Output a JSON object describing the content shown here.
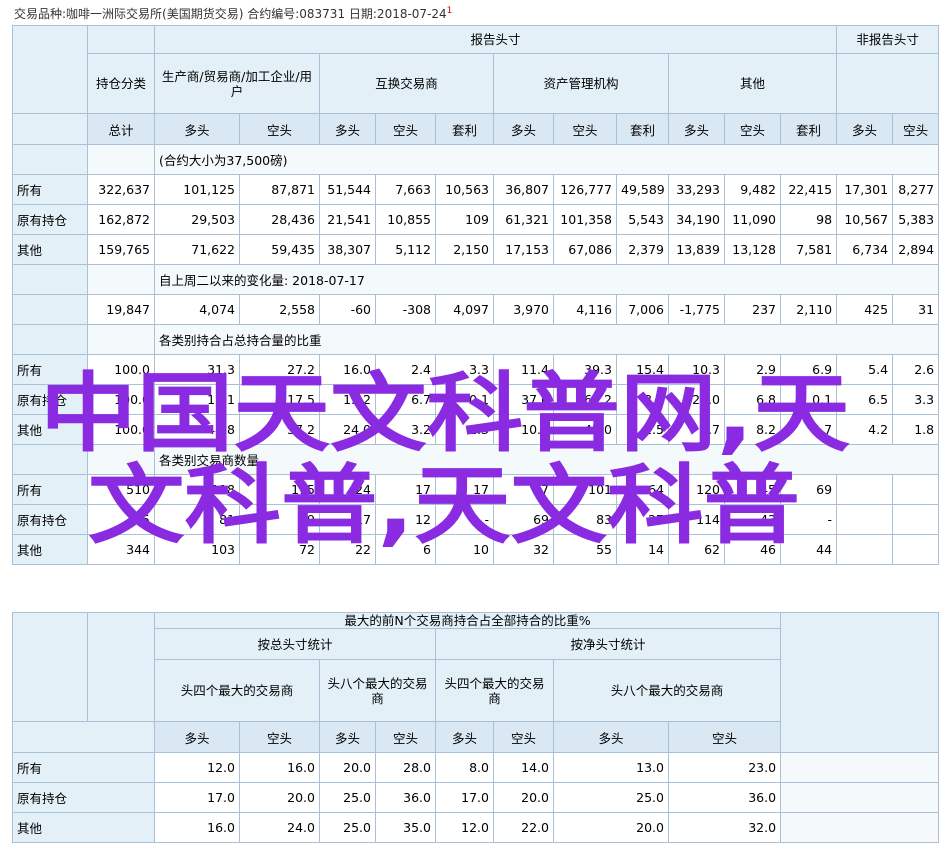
{
  "header": {
    "text": "交易品种:咖啡一洲际交易所(美国期货交易) 合约编号:083731 日期:2018-07-24",
    "mark": "1"
  },
  "t1": {
    "reportable": "报告头寸",
    "nonreportable": "非报告头寸",
    "classification": "持仓分类",
    "groups": [
      "生产商/贸易商/加工企业/用户",
      "互换交易商",
      "资产管理机构",
      "其他"
    ],
    "cols": [
      "总计",
      "多头",
      "空头",
      "多头",
      "空头",
      "套利",
      "多头",
      "空头",
      "套利",
      "多头",
      "空头",
      "套利",
      "多头",
      "空头"
    ],
    "section_contract": "(合约大小为37,500磅)",
    "rows_main": [
      {
        "label": "所有",
        "values": [
          "322,637",
          "101,125",
          "87,871",
          "51,544",
          "7,663",
          "10,563",
          "36,807",
          "126,777",
          "49,589",
          "33,293",
          "9,482",
          "22,415",
          "17,301",
          "8,277"
        ]
      },
      {
        "label": "原有持仓",
        "values": [
          "162,872",
          "29,503",
          "28,436",
          "21,541",
          "10,855",
          "109",
          "61,321",
          "101,358",
          "5,543",
          "34,190",
          "11,090",
          "98",
          "10,567",
          "5,383"
        ]
      },
      {
        "label": "其他",
        "values": [
          "159,765",
          "71,622",
          "59,435",
          "38,307",
          "5,112",
          "2,150",
          "17,153",
          "67,086",
          "2,379",
          "13,839",
          "13,128",
          "7,581",
          "6,734",
          "2,894"
        ]
      }
    ],
    "section_change": "自上周二以来的变化量: 2018-07-17",
    "rows_change": [
      {
        "label": "",
        "values": [
          "19,847",
          "4,074",
          "2,558",
          "-60",
          "-308",
          "4,097",
          "3,970",
          "4,116",
          "7,006",
          "-1,775",
          "237",
          "2,110",
          "425",
          "31"
        ]
      }
    ],
    "section_pct": "各类别持合占总持合量的比重",
    "rows_pct": [
      {
        "label": "所有",
        "values": [
          "100.0",
          "31.3",
          "27.2",
          "16.0",
          "2.4",
          "3.3",
          "11.4",
          "39.3",
          "15.4",
          "10.3",
          "2.9",
          "6.9",
          "5.4",
          "2.6"
        ]
      },
      {
        "label": "原有持仓",
        "values": [
          "100.0",
          "18.1",
          "17.5",
          "13.2",
          "6.7",
          "0.1",
          "37.6",
          "62.2",
          "3.4",
          "21.0",
          "6.8",
          "0.1",
          "6.5",
          "3.3"
        ]
      },
      {
        "label": "其他",
        "values": [
          "100.0",
          "44.8",
          "37.2",
          "24.0",
          "3.2",
          "1.3",
          "10.7",
          "42.0",
          "1.5",
          "8.7",
          "8.2",
          "4.7",
          "4.2",
          "1.8"
        ]
      }
    ],
    "section_traders": "各类别交易商数量",
    "rows_traders": [
      {
        "label": "所有",
        "values": [
          "510",
          "118",
          "115",
          "24",
          "17",
          "17",
          "57",
          "101",
          "64",
          "120",
          "45",
          "69",
          "",
          ""
        ]
      },
      {
        "label": "原有持仓",
        "values": [
          "465",
          "81",
          "59",
          "17",
          "12",
          "-",
          "69",
          "83",
          "27",
          "114",
          "43",
          "-",
          "",
          ""
        ]
      },
      {
        "label": "其他",
        "values": [
          "344",
          "103",
          "72",
          "22",
          "6",
          "10",
          "32",
          "55",
          "14",
          "62",
          "46",
          "44",
          "",
          ""
        ]
      }
    ]
  },
  "t2": {
    "title": "最大的前N个交易商持合占全部持合的比重%",
    "gross": "按总头寸统计",
    "net": "按净头寸统计",
    "sub": [
      "头四个最大的交易商",
      "头八个最大的交易商",
      "头四个最大的交易商",
      "头八个最大的交易商"
    ],
    "cols": [
      "多头",
      "空头",
      "多头",
      "空头",
      "多头",
      "空头",
      "多头",
      "空头"
    ],
    "rows": [
      {
        "label": "所有",
        "values": [
          "12.0",
          "16.0",
          "20.0",
          "28.0",
          "8.0",
          "14.0",
          "13.0",
          "23.0"
        ]
      },
      {
        "label": "原有持仓",
        "values": [
          "17.0",
          "20.0",
          "25.0",
          "36.0",
          "17.0",
          "20.0",
          "25.0",
          "36.0"
        ]
      },
      {
        "label": "其他",
        "values": [
          "16.0",
          "24.0",
          "25.0",
          "35.0",
          "12.0",
          "22.0",
          "20.0",
          "32.0"
        ]
      }
    ]
  },
  "watermark": {
    "line1": "中国天文科普网,天",
    "line2": "文科普,天文科普",
    "color": "#8a2be2"
  }
}
